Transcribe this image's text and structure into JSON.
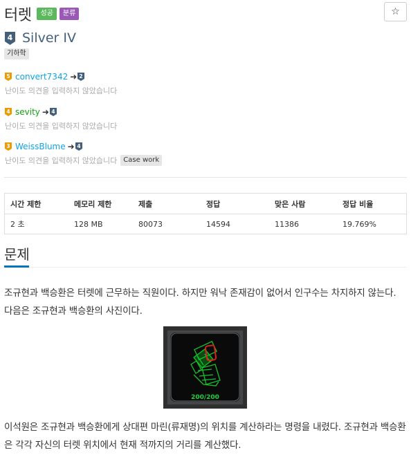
{
  "problem": {
    "title": "터렛",
    "badges": {
      "success": "성공",
      "category": "분류"
    },
    "star": "☆",
    "tier": {
      "number": "4",
      "name": "Silver IV",
      "color": "#435f7a"
    },
    "algorithm_tag": "기하학"
  },
  "opinions": [
    {
      "from_tier": "5",
      "user": "convert7342",
      "to_tier": "2",
      "note": "난이도 의견을 입력하지 않았습니다",
      "tag": ""
    },
    {
      "from_tier": "4",
      "user": "sevity",
      "to_tier": "4",
      "note": "난이도 의견을 입력하지 않았습니다",
      "tag": ""
    },
    {
      "from_tier": "3",
      "user": "WeissBlume",
      "to_tier": "4",
      "note": "난이도 의견을 입력하지 않았습니다",
      "tag": "Case work"
    }
  ],
  "info_table": {
    "headers": [
      "시간 제한",
      "메모리 제한",
      "제출",
      "정답",
      "맞은 사람",
      "정답 비율"
    ],
    "row": [
      "2 초",
      "128 MB",
      "80073",
      "14594",
      "11386",
      "19.769%"
    ]
  },
  "section": {
    "title": "문제"
  },
  "body": {
    "paragraph1": "조규현과 백승환은 터렛에 근무하는 직원이다. 하지만 워낙 존재감이 없어서 인구수는 차지하지 않는다. 다음은 조규현과 백승환의 사진이다.",
    "image_caption": "200/200",
    "paragraph2": "이석원은 조규현과 백승환에게 상대편 마린(류재명)의 위치를 계산하라는 명령을 내렸다. 조규현과 백승환은 각각 자신의 터렛 위치에서 현재 적까지의 거리를 계산했다."
  },
  "colors": {
    "accent": "#0076c0",
    "success": "#5cb85c",
    "category": "#9b59b6",
    "silver": "#435f7a",
    "gold": "#ec9a00",
    "user_blue": "#0ca5e8"
  }
}
